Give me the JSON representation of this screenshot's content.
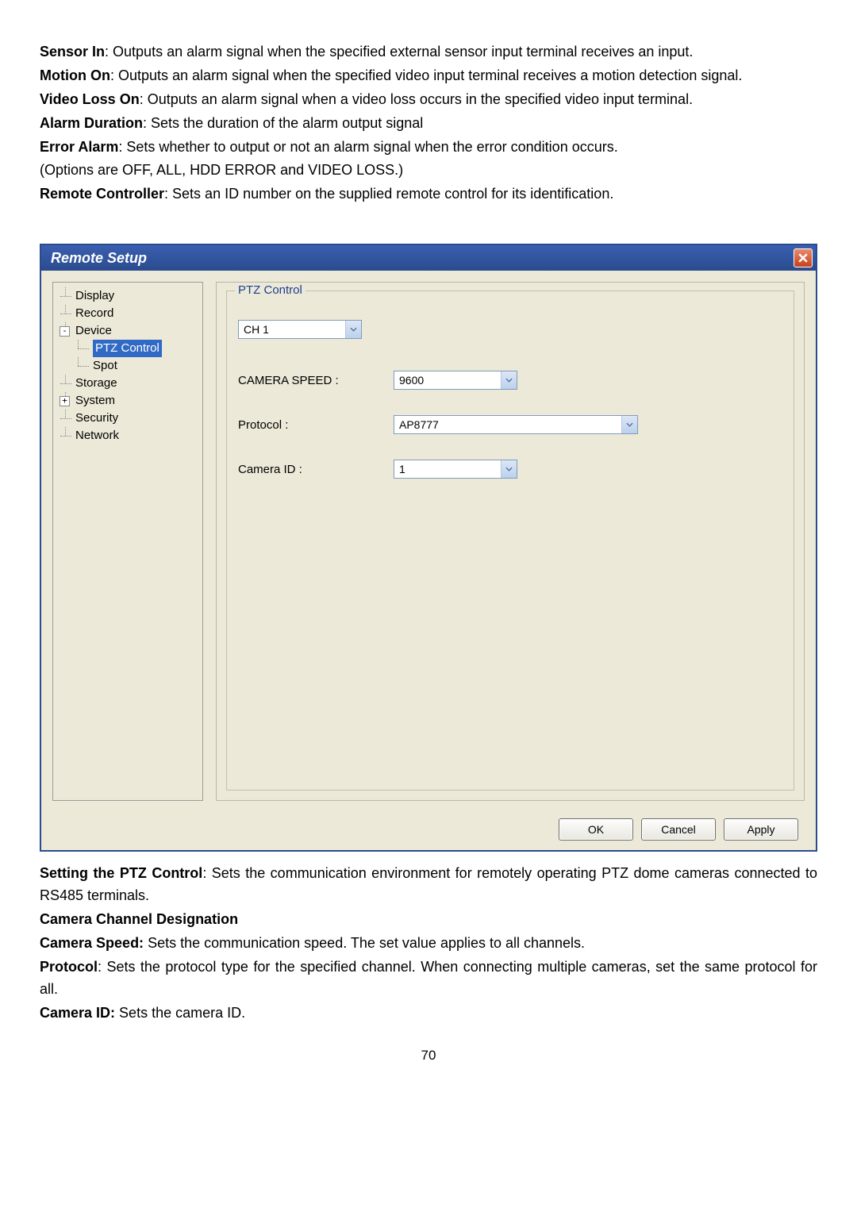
{
  "paragraphs": {
    "p1_bold": "Sensor In",
    "p1_rest": ": Outputs an alarm signal when the specified external sensor input terminal receives an input.",
    "p2_bold": "Motion On",
    "p2_rest": ": Outputs an alarm signal when the specified video input terminal receives a motion detection signal.",
    "p3_bold": "Video Loss On",
    "p3_rest": ": Outputs an alarm signal when a video loss occurs in the specified video input terminal.",
    "p4_bold": "Alarm Duration",
    "p4_rest": ": Sets the duration of the alarm output signal",
    "p5_bold": "Error Alarm",
    "p5_rest": ": Sets whether to output or not an alarm signal when the error condition occurs.",
    "p6": "(Options are OFF, ALL, HDD ERROR and VIDEO LOSS.)",
    "p7_bold": "Remote Controller",
    "p7_rest": ": Sets an ID number on the supplied remote control for its identification."
  },
  "dialog": {
    "title": "Remote Setup",
    "tree": {
      "items": {
        "display": "Display",
        "record": "Record",
        "device": "Device",
        "ptz": "PTZ Control",
        "spot": "Spot",
        "storage": "Storage",
        "system": "System",
        "security": "Security",
        "network": "Network"
      }
    },
    "panel": {
      "legend": "PTZ Control",
      "channel": "CH 1",
      "labels": {
        "speed": "CAMERA SPEED :",
        "protocol": "Protocol :",
        "cameraid": "Camera ID :"
      },
      "values": {
        "speed": "9600",
        "protocol": "AP8777",
        "cameraid": "1"
      }
    },
    "buttons": {
      "ok": "OK",
      "cancel": "Cancel",
      "apply": "Apply"
    }
  },
  "lower": {
    "p1_bold": "Setting the PTZ Control",
    "p1_rest": ": Sets the communication environment for remotely operating PTZ dome cameras connected to RS485 terminals.",
    "p2_bold": "Camera Channel Designation",
    "p3_bold": "Camera Speed:",
    "p3_rest": " Sets the communication speed. The set value applies to all channels.",
    "p4_bold": "Protocol",
    "p4_rest": ": Sets the protocol type for the specified channel. When connecting multiple cameras, set the same protocol for all.",
    "p5_bold": "Camera ID:",
    "p5_rest": " Sets the camera ID."
  },
  "page_number": "70"
}
